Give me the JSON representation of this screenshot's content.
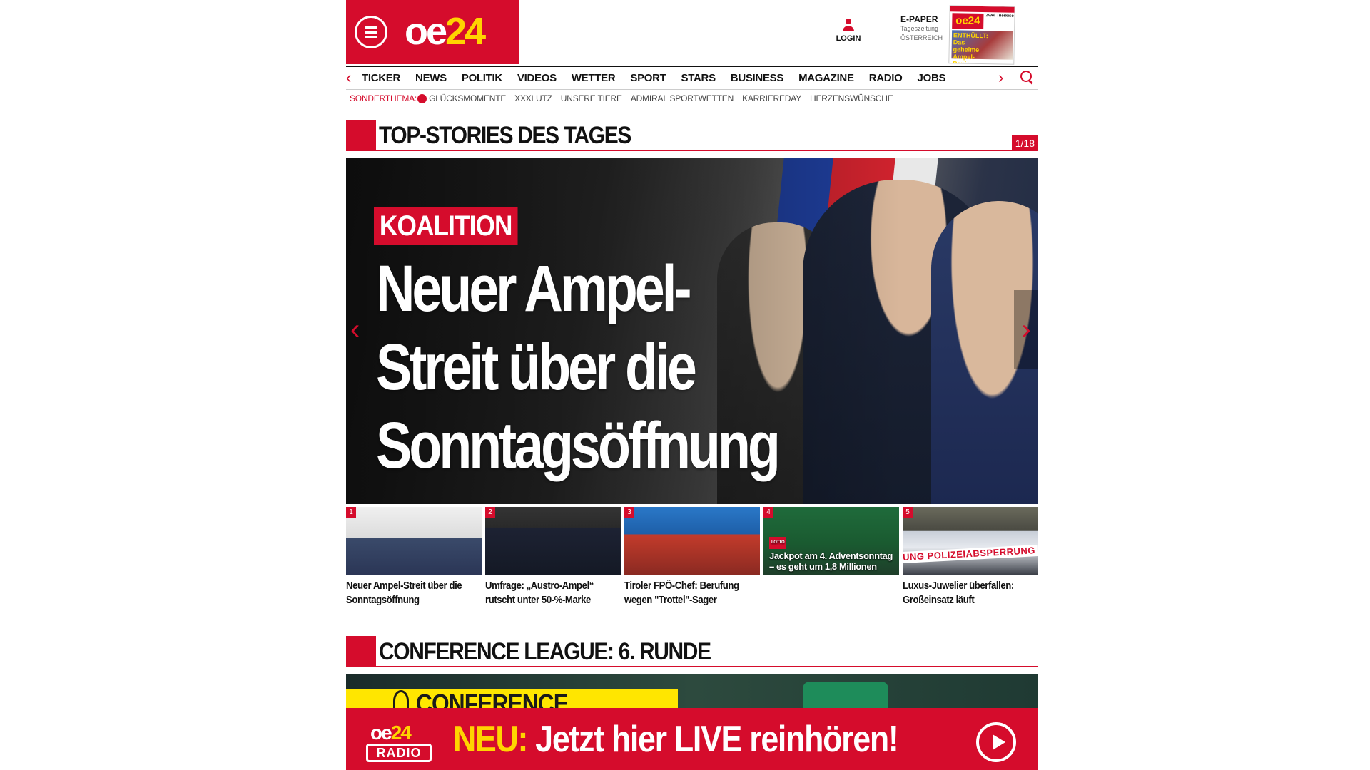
{
  "header": {
    "logo": {
      "oe": "oe",
      "n24": "24"
    },
    "login_label": "LOGIN",
    "epaper": {
      "title": "E-PAPER",
      "sub1": "Tageszeitung",
      "sub2": "ÖSTERREICH",
      "cover_headline": "Zwei Tuerkise",
      "cover_text": "ENTHÜLLT: Das geheime Ampel-Papier"
    }
  },
  "nav": {
    "items": [
      "TICKER",
      "NEWS",
      "POLITIK",
      "VIDEOS",
      "WETTER",
      "SPORT",
      "STARS",
      "BUSINESS",
      "MAGAZINE",
      "RADIO",
      "JOBS"
    ]
  },
  "subnav": {
    "label": "SONDERTHEMA:",
    "items": [
      "GLÜCKSMOMENTE",
      "XXXLUTZ",
      "UNSERE TIERE",
      "ADMIRAL SPORTWETTEN",
      "KARRIEREDAY",
      "HERZENSWÜNSCHE"
    ]
  },
  "top_stories": {
    "title": "TOP-STORIES DES TAGES",
    "counter": "1/18",
    "hero": {
      "kicker": "KOALITION",
      "headline": "Neuer Ampel-Streit über die Sonntagsöffnung"
    },
    "thumbs": [
      {
        "num": "1",
        "caption": "Neuer Ampel-Streit über die Sonntagsöffnung"
      },
      {
        "num": "2",
        "caption": "Umfrage: „Austro-Ampel“ rutscht unter 50-%-Marke"
      },
      {
        "num": "3",
        "caption": "Tiroler FPÖ-Chef: Berufung wegen \"Trottel\"-Sager"
      },
      {
        "num": "4",
        "caption": "",
        "overlay_tag": "LOTTO",
        "overlay": "Jackpot am 4. Adventsonntag – es geht um 1,8 Millionen"
      },
      {
        "num": "5",
        "caption": "Luxus-Juwelier überfallen: Großeinsatz läuft",
        "tape": "UNG POLIZEIABSPERRUNG"
      }
    ]
  },
  "conference": {
    "title": "CONFERENCE LEAGUE: 6. RUNDE",
    "banner_text": "CONFERENCE LEAGUE"
  },
  "radio": {
    "logo_line1_oe": "oe",
    "logo_line1_24": "24",
    "logo_line2": "RADIO",
    "neu": "NEU:",
    "text": " Jetzt hier LIVE reinhören!"
  }
}
